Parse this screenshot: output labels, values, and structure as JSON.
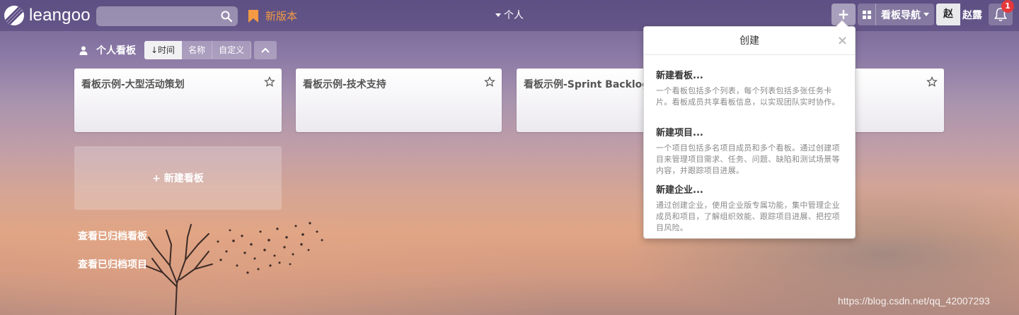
{
  "header": {
    "logo_text": "leangoo",
    "search": {
      "value": "",
      "placeholder": ""
    },
    "version_label": "新版本",
    "mode_switch": "个人",
    "add_button": "+",
    "board_nav_label": "看板导航",
    "avatar_text": "赵",
    "username": "赵露",
    "notification_count": "1"
  },
  "toolbar": {
    "title": "个人看板",
    "sort_options": [
      "↓时间",
      "名称",
      "自定义"
    ],
    "active_sort": 0
  },
  "boards": [
    {
      "title": "看板示例-大型活动策划"
    },
    {
      "title": "看板示例-技术支持"
    },
    {
      "title": "看板示例-Sprint Backlog"
    },
    {
      "title": ""
    }
  ],
  "new_board_label": "+ 新建看板",
  "archive_links": [
    "查看已归档看板",
    "查看已归档项目"
  ],
  "popover": {
    "title": "创建",
    "close": "×",
    "items": [
      {
        "title": "新建看板...",
        "desc": "一个看板包括多个列表，每个列表包括多张任务卡片。看板成员共享看板信息，以实现团队实时协作。"
      },
      {
        "title": "新建项目...",
        "desc": "一个项目包括多名项目成员和多个看板。通过创建项目来管理项目需求、任务、问题、缺陷和测试场景等内容，并跟踪项目进展。"
      },
      {
        "title": "新建企业...",
        "desc": "通过创建企业，使用企业版专属功能，集中管理企业成员和项目，了解组织效能、跟踪项目进展、把控项目风险。"
      }
    ]
  },
  "watermark": "https://blog.csdn.net/qq_42007293",
  "colors": {
    "accent_orange": "#f39a42",
    "badge_red": "#e5383b",
    "topbar": "#504276"
  }
}
